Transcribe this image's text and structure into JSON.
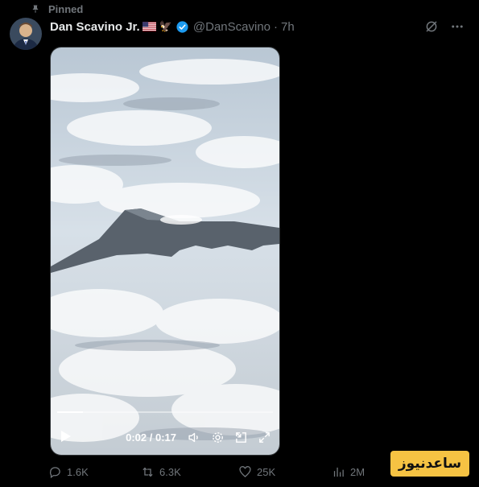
{
  "pinned_label": "Pinned",
  "author": {
    "name": "Dan Scavino Jr.",
    "handle": "@DanScavino",
    "separator": "·",
    "time": "7h"
  },
  "icons": {
    "pin": "pin-icon",
    "flag": "us-flag-icon",
    "eagle": "🦅",
    "verified": "verified-badge-icon",
    "grok": "grok-icon",
    "more": "more-icon"
  },
  "video": {
    "elapsed": "0:02",
    "duration": "0:17",
    "timecode": "0:02 / 0:17",
    "progress_fraction": 0.12
  },
  "actions": {
    "replies": "1.6K",
    "reposts": "6.3K",
    "likes": "25K",
    "views": "2M"
  },
  "watermark": {
    "text": "ساعدنیوز"
  },
  "colors": {
    "background": "#000000",
    "text": "#e7e9ea",
    "muted": "#71767b",
    "verified": "#1d9bf0",
    "watermark_bg": "#f6c343"
  }
}
